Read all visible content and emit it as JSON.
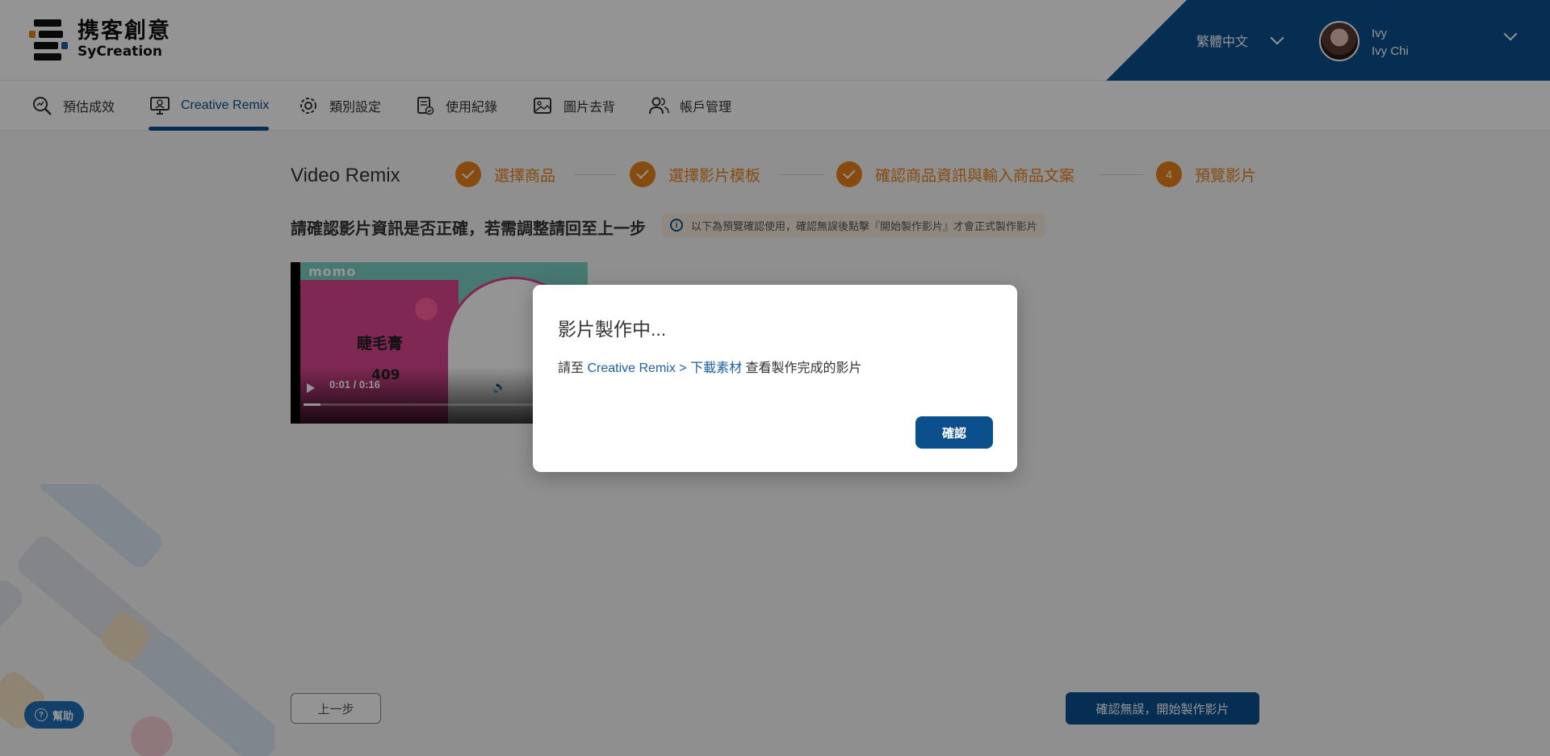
{
  "header": {
    "logo_cn": "携客創意",
    "logo_en": "SyCreation",
    "language": "繁體中文",
    "user_name": "Ivy",
    "user_fullname": "Ivy Chi"
  },
  "nav": {
    "items": [
      {
        "label": "預估成效",
        "icon": "analytics-search-icon"
      },
      {
        "label": "Creative Remix",
        "icon": "monitor-user-icon",
        "active": true
      },
      {
        "label": "類別設定",
        "icon": "gear-icon"
      },
      {
        "label": "使用紀錄",
        "icon": "document-check-icon"
      },
      {
        "label": "圖片去背",
        "icon": "image-icon"
      },
      {
        "label": "帳戶管理",
        "icon": "users-icon"
      }
    ]
  },
  "steps": {
    "title": "Video Remix",
    "items": [
      {
        "label": "選擇商品",
        "state": "done"
      },
      {
        "label": "選擇影片模板",
        "state": "done"
      },
      {
        "label": "確認商品資訊與輸入商品文案",
        "state": "done"
      },
      {
        "label": "預覽影片",
        "state": "current",
        "number": "4"
      }
    ]
  },
  "main": {
    "confirm_text": "請確認影片資訊是否正確，若需調整請回至上一步",
    "note": "以下為預覽確認使用，確認無誤後點擊『開始製作影片』才會正式製作影片"
  },
  "video": {
    "brand": "momo",
    "product_name": "睫毛膏",
    "price": "409",
    "time": "0:01 / 0:16",
    "progress": 0.0625
  },
  "buttons": {
    "prev": "上一步",
    "start": "確認無誤，開始製作影片",
    "help": "幫助"
  },
  "dialog": {
    "title": "影片製作中...",
    "body_prefix": "請至",
    "body_link": "Creative Remix > 下載素材",
    "body_suffix": "查看製作完成的影片",
    "ok": "確認"
  },
  "colors": {
    "brand_blue": "#0b4f8d",
    "accent_orange": "#e8821a"
  }
}
